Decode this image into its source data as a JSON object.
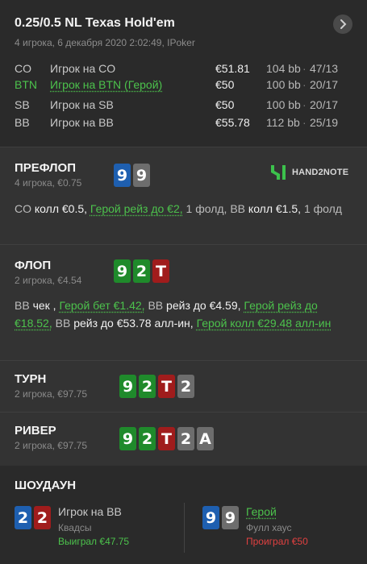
{
  "header": {
    "title": "0.25/0.5 NL Texas Hold'em",
    "subtitle": "4 игрока, 6 декабря 2020 2:02:49, IPoker"
  },
  "players": [
    {
      "pos": "CO",
      "name": "Игрок на CO",
      "stack": "€51.81",
      "bb": "104 bb",
      "sep": "·",
      "stat": "47/13",
      "hero": false
    },
    {
      "pos": "BTN",
      "name": "Игрок на BTN (Герой)",
      "stack": "€50",
      "bb": "100 bb",
      "sep": "·",
      "stat": "20/17",
      "hero": true
    },
    {
      "pos": "SB",
      "name": "Игрок на SB",
      "stack": "€50",
      "bb": "100 bb",
      "sep": "·",
      "stat": "20/17",
      "hero": false
    },
    {
      "pos": "BB",
      "name": "Игрок на BB",
      "stack": "€55.78",
      "bb": "112 bb",
      "sep": "·",
      "stat": "25/19",
      "hero": false
    }
  ],
  "preflop": {
    "title": "ПРЕФЛОП",
    "sub": "4 игрока, €0.75",
    "cards": [
      "9",
      "9"
    ],
    "logo": "HAND2NOTE",
    "actions": {
      "a1": "CO",
      "a2": "колл €0.5,",
      "a3": "Герой рейз до €2,",
      "a4": "1 фолд, BB",
      "a5": "колл €1.5,",
      "a6": "1 фолд"
    }
  },
  "flop": {
    "title": "ФЛОП",
    "sub": "2 игрока, €4.54",
    "cards": [
      "9",
      "2",
      "T"
    ],
    "actions": {
      "a1": "BB",
      "a2": "чек ,",
      "a3": "Герой бет €1.42,",
      "a4": "BB",
      "a5": "рейз до €4.59,",
      "a6": "Герой рейз до €18.52,",
      "a7": "BB",
      "a8": "рейз до €53.78 алл-ин,",
      "a9": "Герой колл €29.48 алл-ин"
    }
  },
  "turn": {
    "title": "ТУРН",
    "sub": "2 игрока, €97.75",
    "cards": [
      "9",
      "2",
      "T",
      "2"
    ]
  },
  "river": {
    "title": "РИВЕР",
    "sub": "2 игрока, €97.75",
    "cards": [
      "9",
      "2",
      "T",
      "2",
      "A"
    ]
  },
  "showdown": {
    "title": "ШОУДАУН",
    "left": {
      "cards": [
        "2",
        "2"
      ],
      "name": "Игрок на BB",
      "hand": "Квадсы",
      "result": "Выиграл €47.75"
    },
    "right": {
      "cards": [
        "9",
        "9"
      ],
      "name": "Герой",
      "hand": "Фулл хаус",
      "result": "Проиграл €50"
    }
  },
  "colors": {
    "blue": "#1e5fb0",
    "green": "#1f8a2b",
    "red": "#a01c1c",
    "gray": "#6d6d6d",
    "hero": "#4cc24c"
  }
}
